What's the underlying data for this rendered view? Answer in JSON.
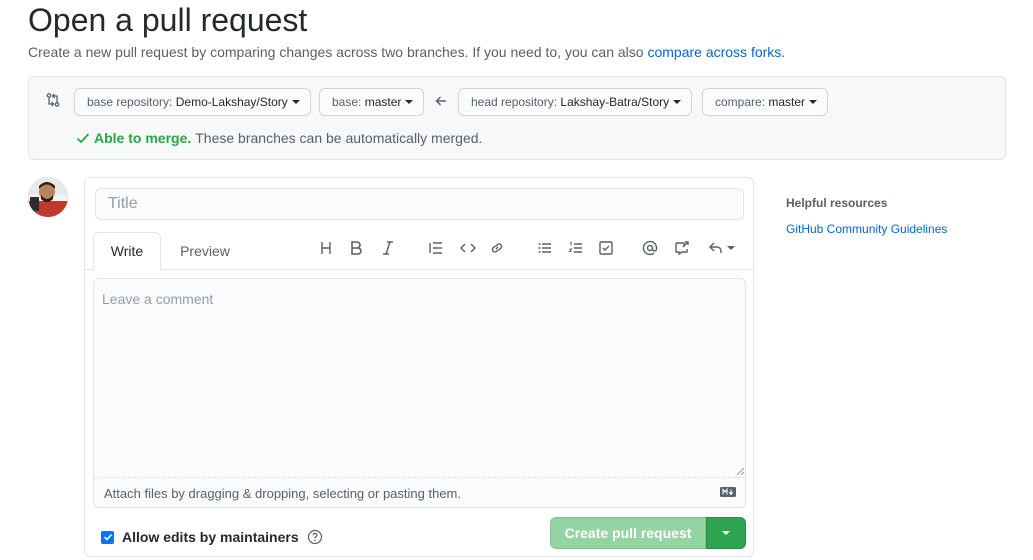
{
  "header": {
    "title": "Open a pull request",
    "subtitle": "Create a new pull request by comparing changes across two branches. If you need to, you can also",
    "subtitle_link": "compare across forks."
  },
  "range": {
    "base_repo_label": "base repository:",
    "base_repo_value": "Demo-Lakshay/Story",
    "base_label": "base:",
    "base_value": "master",
    "head_repo_label": "head repository:",
    "head_repo_value": "Lakshay-Batra/Story",
    "compare_label": "compare:",
    "compare_value": "master",
    "merge_status_strong": "Able to merge.",
    "merge_status_text": "These branches can be automatically merged.",
    "merge_color": "#28a745"
  },
  "form": {
    "title_placeholder": "Title",
    "tabs": [
      {
        "label": "Write"
      },
      {
        "label": "Preview"
      }
    ],
    "toolbar_icons": [
      "heading-icon",
      "bold-icon",
      "italic-icon",
      "quote-icon",
      "code-icon",
      "link-icon",
      "bulleted-list-icon",
      "numbered-list-icon",
      "task-list-icon",
      "mention-icon",
      "cross-reference-icon",
      "reply-icon"
    ],
    "comment_placeholder": "Leave a comment",
    "attach_text": "Attach files by dragging & dropping, selecting or pasting them.",
    "allow_edits_label": "Allow edits by maintainers",
    "allow_edits_checked": true,
    "create_button": "Create pull request",
    "create_button_color": "#94d3a2",
    "dropdown_color": "#2ea44f"
  },
  "sidebar": {
    "heading": "Helpful resources",
    "link": "GitHub Community Guidelines"
  }
}
